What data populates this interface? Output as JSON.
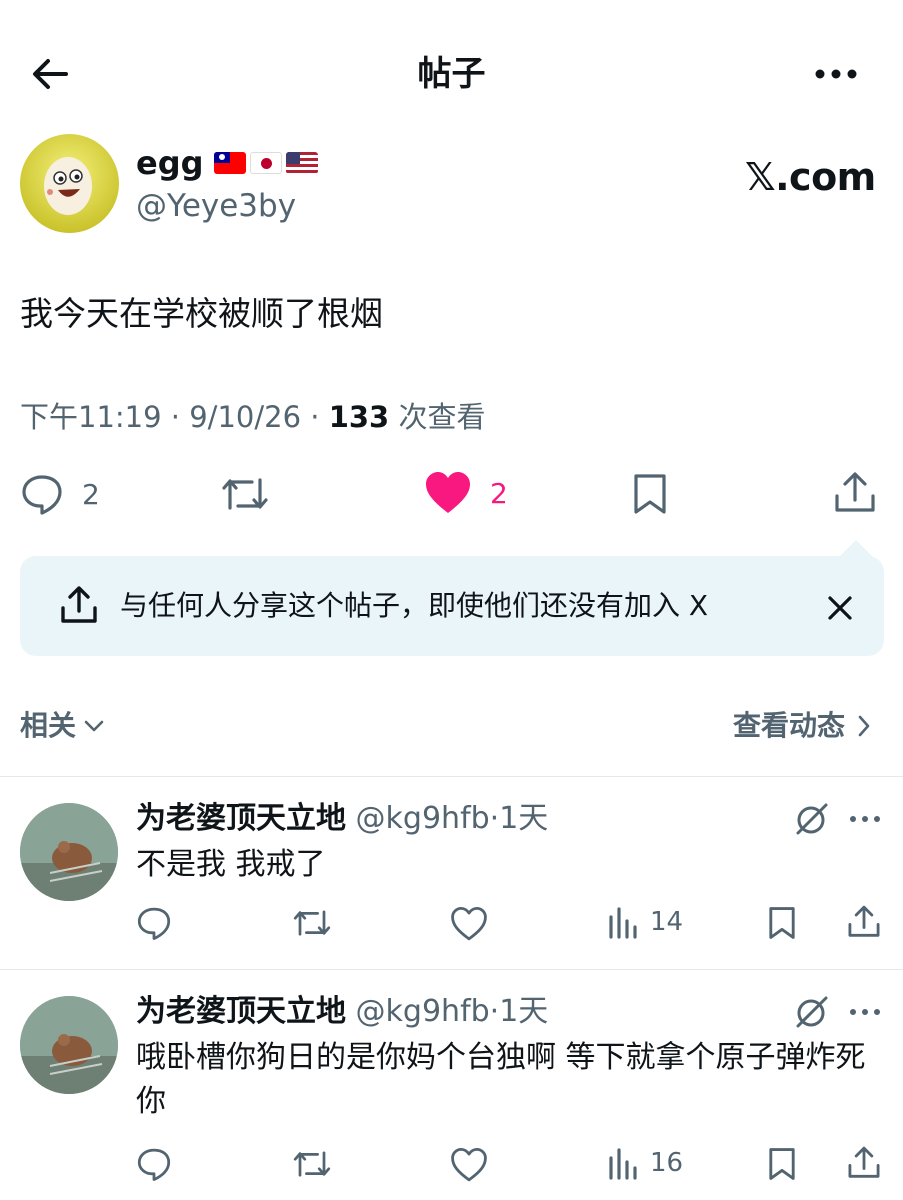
{
  "header": {
    "title": "帖子"
  },
  "author": {
    "name": "egg",
    "handle": "@Yeye3by",
    "brand": "𝕏.com",
    "flags": [
      "taiwan-flag",
      "japan-flag",
      "usa-flag"
    ]
  },
  "post": {
    "text": "我今天在学校被顺了根烟",
    "time": "下午11:19",
    "date": "9/10/26",
    "views": "133",
    "views_label": "次查看",
    "sep": "·"
  },
  "actions": {
    "replies": "2",
    "likes": "2"
  },
  "share_banner": {
    "text": "与任何人分享这个帖子，即使他们还没有加入 X"
  },
  "related": {
    "label": "相关",
    "activity_link": "查看动态"
  },
  "replies": [
    {
      "name": "为老婆顶天立地",
      "handle": "@kg9hfb",
      "time": "1天",
      "text": "不是我 我戒了",
      "views": "14"
    },
    {
      "name": "为老婆顶天立地",
      "handle": "@kg9hfb",
      "time": "1天",
      "text": "哦卧槽你狗日的是你妈个台独啊 等下就拿个原子弹炸死你",
      "views": "16"
    }
  ],
  "colors": {
    "like": "#f91880",
    "muted": "#536471",
    "banner_bg": "#eaf5fa",
    "text": "#0f1419"
  }
}
